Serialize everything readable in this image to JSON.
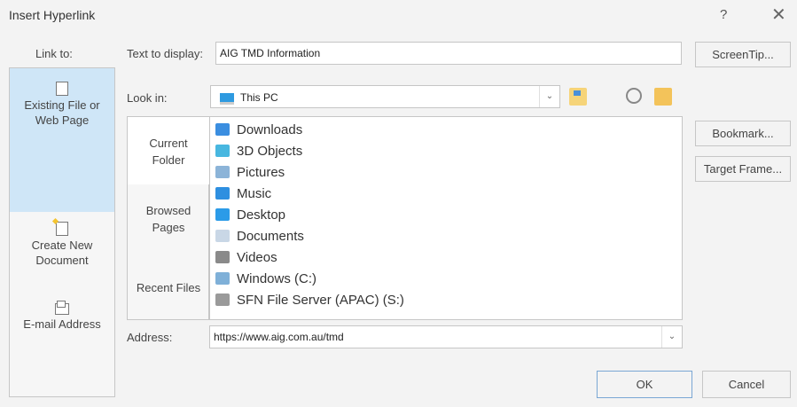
{
  "dialog": {
    "title": "Insert Hyperlink",
    "help": "?",
    "close": "✕"
  },
  "sidebar": {
    "label": "Link to:",
    "items": [
      {
        "label": "Existing File or Web Page",
        "icon": "web-page-icon"
      },
      {
        "label": "Create New Document",
        "icon": "new-document-icon"
      },
      {
        "label": "E-mail Address",
        "icon": "email-icon"
      }
    ]
  },
  "text_to_display": {
    "label": "Text to display:",
    "value": "AIG TMD Information"
  },
  "buttons": {
    "screentip": "ScreenTip...",
    "bookmark": "Bookmark...",
    "target_frame": "Target Frame...",
    "ok": "OK",
    "cancel": "Cancel"
  },
  "look_in": {
    "label": "Look in:",
    "value": "This PC"
  },
  "views": [
    "Current Folder",
    "Browsed Pages",
    "Recent Files"
  ],
  "files": [
    {
      "name": "Downloads",
      "icon": "download-arrow-icon",
      "color": "#3b8ee0"
    },
    {
      "name": "3D Objects",
      "icon": "cube-icon",
      "color": "#48b7e0"
    },
    {
      "name": "Pictures",
      "icon": "pictures-icon",
      "color": "#8cb4d8"
    },
    {
      "name": "Music",
      "icon": "music-note-icon",
      "color": "#2e8fe0"
    },
    {
      "name": "Desktop",
      "icon": "desktop-icon",
      "color": "#2b9be8"
    },
    {
      "name": "Documents",
      "icon": "documents-icon",
      "color": "#c9d7e6"
    },
    {
      "name": "Videos",
      "icon": "film-icon",
      "color": "#8a8a8a"
    },
    {
      "name": "Windows (C:)",
      "icon": "drive-icon",
      "color": "#7fb0d8"
    },
    {
      "name": "SFN File Server (APAC) (S:)",
      "icon": "network-drive-icon",
      "color": "#9a9a9a"
    }
  ],
  "address": {
    "label": "Address:",
    "value": "https://www.aig.com.au/tmd"
  }
}
